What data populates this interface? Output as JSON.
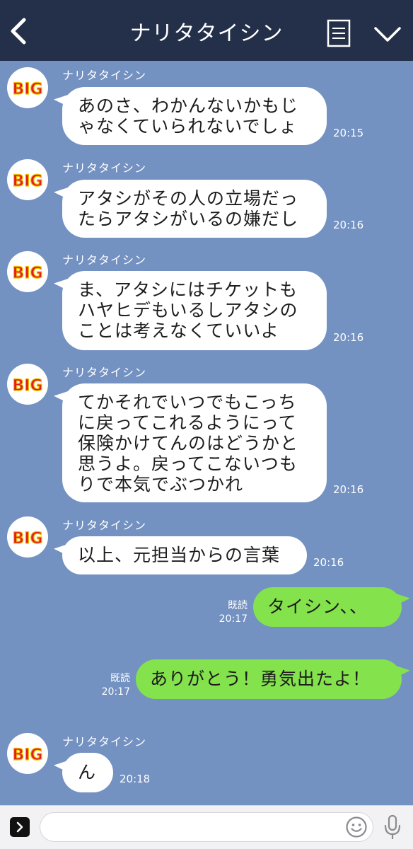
{
  "header": {
    "title": "ナリタタイシン",
    "back_icon": "chevron-left-icon",
    "menu_icon": "menu-list-icon",
    "collapse_icon": "chevron-down-icon",
    "background": "#243049"
  },
  "contact": {
    "name": "ナリタタイシン",
    "avatar_text": "BIG"
  },
  "messages": [
    {
      "sender": "ナリタタイシン",
      "direction": "incoming",
      "text": "あのさ、わかんないかもじ\nゃなくていられないでしょ",
      "time": "20:15"
    },
    {
      "sender": "ナリタタイシン",
      "direction": "incoming",
      "text": "アタシがその人の立場だっ\nたらアタシがいるの嫌だし",
      "time": "20:16"
    },
    {
      "sender": "ナリタタイシン",
      "direction": "incoming",
      "text": "ま、アタシにはチケットも\nハヤヒデもいるしアタシの\nことは考えなくていいよ",
      "time": "20:16"
    },
    {
      "sender": "ナリタタイシン",
      "direction": "incoming",
      "text": "てかそれでいつでもこっち\nに戻ってこれるようにって\n保険かけてんのはどうかと\n思うよ。戻ってこないつも\nりで本気でぶつかれ",
      "time": "20:16"
    },
    {
      "sender": "ナリタタイシン",
      "direction": "incoming",
      "text": "以上、元担当からの言葉",
      "time": "20:16"
    },
    {
      "direction": "outgoing",
      "text": "タイシン、、",
      "read": "既読",
      "time": "20:17"
    },
    {
      "direction": "outgoing",
      "text": "ありがとう！勇気出たよ！",
      "read": "既読",
      "time": "20:17"
    },
    {
      "sender": "ナリタタイシン",
      "direction": "incoming",
      "text": "ん",
      "time": "20:18"
    }
  ],
  "input_bar": {
    "placeholder": "",
    "expand_icon": "expand-arrow-icon",
    "emoji_icon": "emoji-icon",
    "mic_icon": "microphone-icon"
  },
  "colors": {
    "chat_background": "#7391c1",
    "incoming_bubble": "#ffffff",
    "outgoing_bubble": "#84e24d",
    "avatar_text": "#e02020",
    "avatar_outline": "#f2c200"
  }
}
